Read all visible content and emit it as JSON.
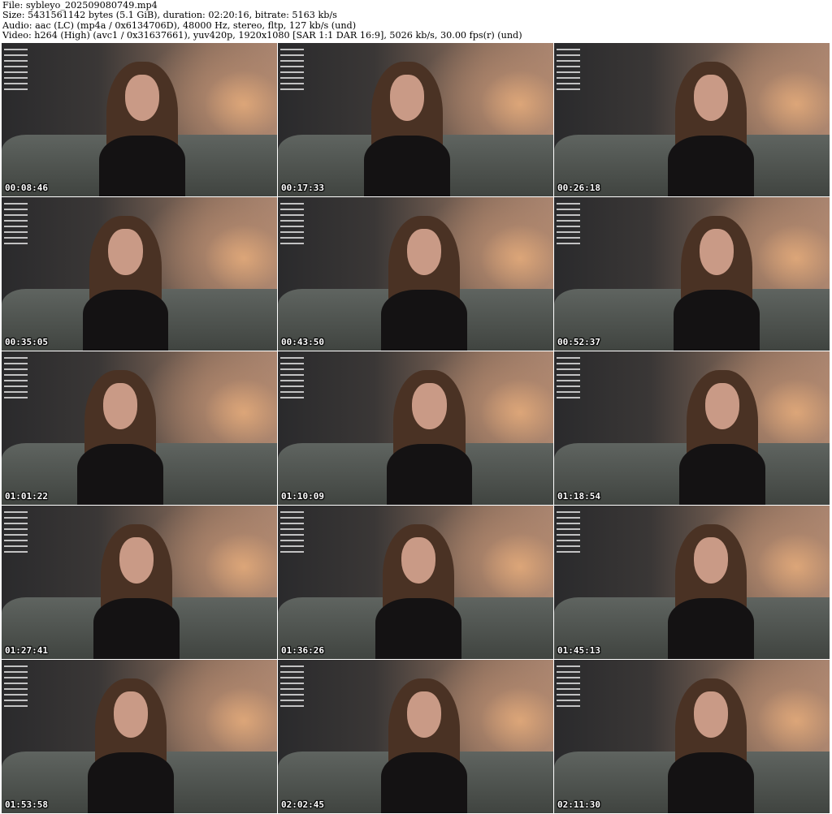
{
  "header": {
    "file": "File: sybleyo_202509080749.mp4",
    "size": "Size: 5431561142 bytes (5.1 GiB), duration: 02:20:16, bitrate: 5163 kb/s",
    "audio": "Audio: aac (LC) (mp4a / 0x6134706D), 48000 Hz, stereo, fltp, 127 kb/s (und)",
    "video": "Video: h264 (High) (avc1 / 0x31637661), yuv420p, 1920x1080 [SAR 1:1 DAR 16:9], 5026 kb/s, 30.00 fps(r) (und)"
  },
  "thumbnails": [
    {
      "timestamp": "00:08:46"
    },
    {
      "timestamp": "00:17:33"
    },
    {
      "timestamp": "00:26:18"
    },
    {
      "timestamp": "00:35:05"
    },
    {
      "timestamp": "00:43:50"
    },
    {
      "timestamp": "00:52:37"
    },
    {
      "timestamp": "01:01:22"
    },
    {
      "timestamp": "01:10:09"
    },
    {
      "timestamp": "01:18:54"
    },
    {
      "timestamp": "01:27:41"
    },
    {
      "timestamp": "01:36:26"
    },
    {
      "timestamp": "01:45:13"
    },
    {
      "timestamp": "01:53:58"
    },
    {
      "timestamp": "02:02:45"
    },
    {
      "timestamp": "02:11:30"
    }
  ]
}
